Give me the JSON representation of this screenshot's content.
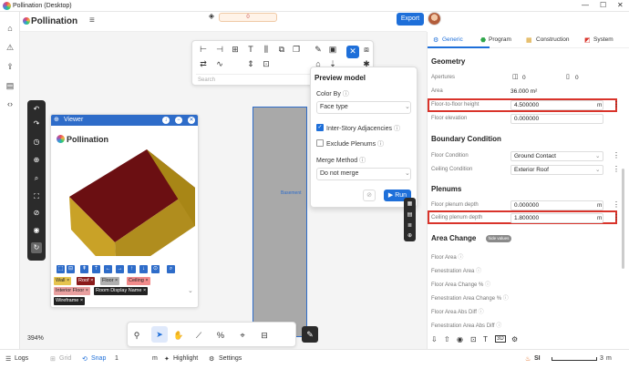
{
  "window": {
    "title": "Pollination (Desktop)"
  },
  "header": {
    "brand": "Pollination",
    "layer_value": "0",
    "export_label": "Export"
  },
  "draw_toolbar": {
    "search_placeholder": "Search"
  },
  "viewer": {
    "title": "Viewer",
    "brand": "Pollination",
    "tags": [
      {
        "label": "Wall ×",
        "color": "#e6c44f"
      },
      {
        "label": "Roof ×",
        "color": "#8b1a1a"
      },
      {
        "label": "Floor ×",
        "color": "#b0b0b0"
      },
      {
        "label": "Ceiling ×",
        "color": "#f28b8b"
      },
      {
        "label": "Interior Floor ×",
        "color": "#e9a0a0"
      },
      {
        "label": "Room Display Name ×",
        "color": "#222222"
      },
      {
        "label": "Wireframe ×",
        "color": "#222222"
      }
    ]
  },
  "viewport": {
    "room_label": "Basement",
    "zoom": "394%"
  },
  "preview": {
    "title": "Preview model",
    "color_by_label": "Color By",
    "color_by_value": "Face type",
    "inter_story_label": "Inter-Story Adjacencies",
    "exclude_plenums_label": "Exclude Plenums",
    "merge_method_label": "Merge Method",
    "merge_method_value": "Do not merge",
    "run_label": "Run"
  },
  "right_panel": {
    "tabs": [
      "Generic",
      "Program",
      "Construction",
      "System"
    ],
    "geometry_title": "Geometry",
    "apertures_label": "Apertures",
    "apertures_a": "0",
    "apertures_b": "0",
    "area_label": "Area",
    "area_value": "36.000 m²",
    "f2f_label": "Floor-to-floor height",
    "f2f_value": "4.500000",
    "f2f_unit": "m",
    "floor_elev_label": "Floor elevation",
    "floor_elev_value": "0.000000",
    "boundary_title": "Boundary Condition",
    "floor_cond_label": "Floor Condition",
    "floor_cond_value": "Ground Contact",
    "ceiling_cond_label": "Ceiling Condition",
    "ceiling_cond_value": "Exterior Roof",
    "plenums_title": "Plenums",
    "floor_plenum_label": "Floor plenum depth",
    "floor_plenum_value": "0.000000",
    "floor_plenum_unit": "m",
    "ceiling_plenum_label": "Ceiling plenum depth",
    "ceiling_plenum_value": "1.800000",
    "ceiling_plenum_unit": "m",
    "area_change_title": "Area Change",
    "area_change_badge": "hide values",
    "ac_rows": [
      "Floor Area",
      "Fenestration Area",
      "Floor Area Change %",
      "Fenestration Area Change %",
      "Floor Area Abs Diff",
      "Fenestration Area Abs Diff"
    ]
  },
  "status": {
    "logs": "Logs",
    "grid": "Grid",
    "snap": "Snap",
    "snap_value": "1",
    "snap_unit": "m",
    "highlight": "Highlight",
    "settings": "Settings",
    "units": "SI",
    "scale_value": "3",
    "scale_unit": "m"
  }
}
